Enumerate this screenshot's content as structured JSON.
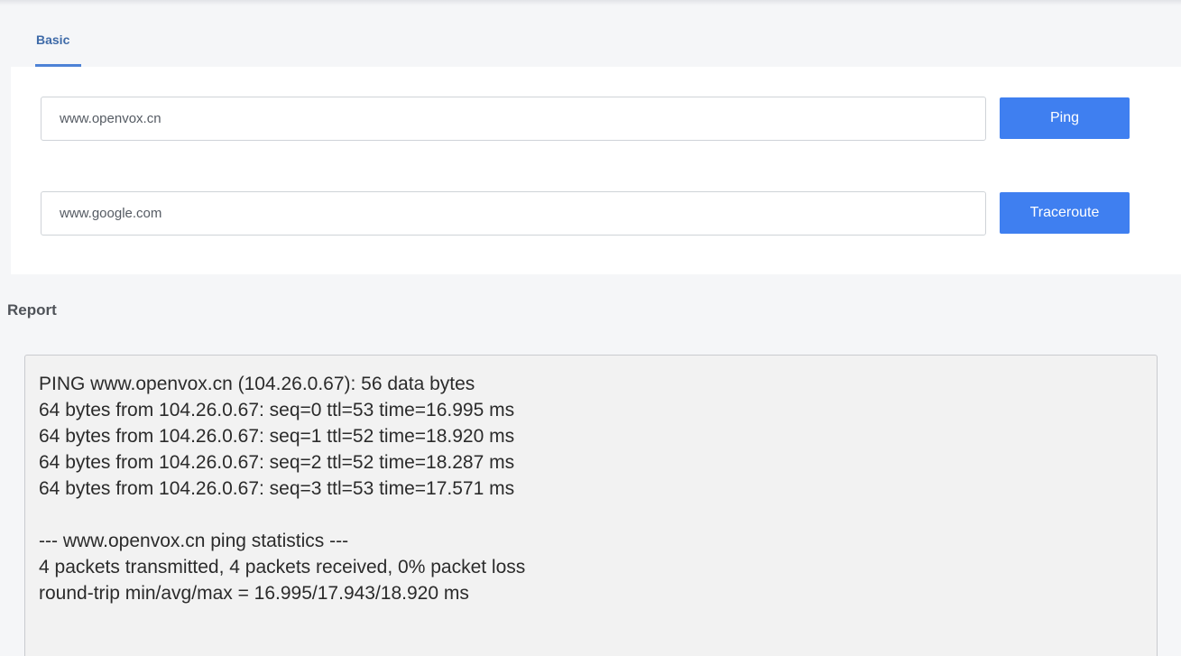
{
  "tabs": [
    {
      "label": "Basic",
      "active": true
    }
  ],
  "ping": {
    "value": "www.openvox.cn",
    "button_label": "Ping"
  },
  "traceroute": {
    "value": "www.google.com",
    "button_label": "Traceroute"
  },
  "report": {
    "title": "Report",
    "lines": [
      "PING www.openvox.cn (104.26.0.67): 56 data bytes",
      "64 bytes from 104.26.0.67: seq=0 ttl=53 time=16.995 ms",
      "64 bytes from 104.26.0.67: seq=1 ttl=52 time=18.920 ms",
      "64 bytes from 104.26.0.67: seq=2 ttl=52 time=18.287 ms",
      "64 bytes from 104.26.0.67: seq=3 ttl=53 time=17.571 ms",
      "",
      "--- www.openvox.cn ping statistics ---",
      "4 packets transmitted, 4 packets received, 0% packet loss",
      "round-trip min/avg/max = 16.995/17.943/18.920 ms"
    ]
  },
  "colors": {
    "accent": "#3f7ff0",
    "tab_active": "#3e6aa8",
    "report_bg": "#f2f2f2"
  }
}
